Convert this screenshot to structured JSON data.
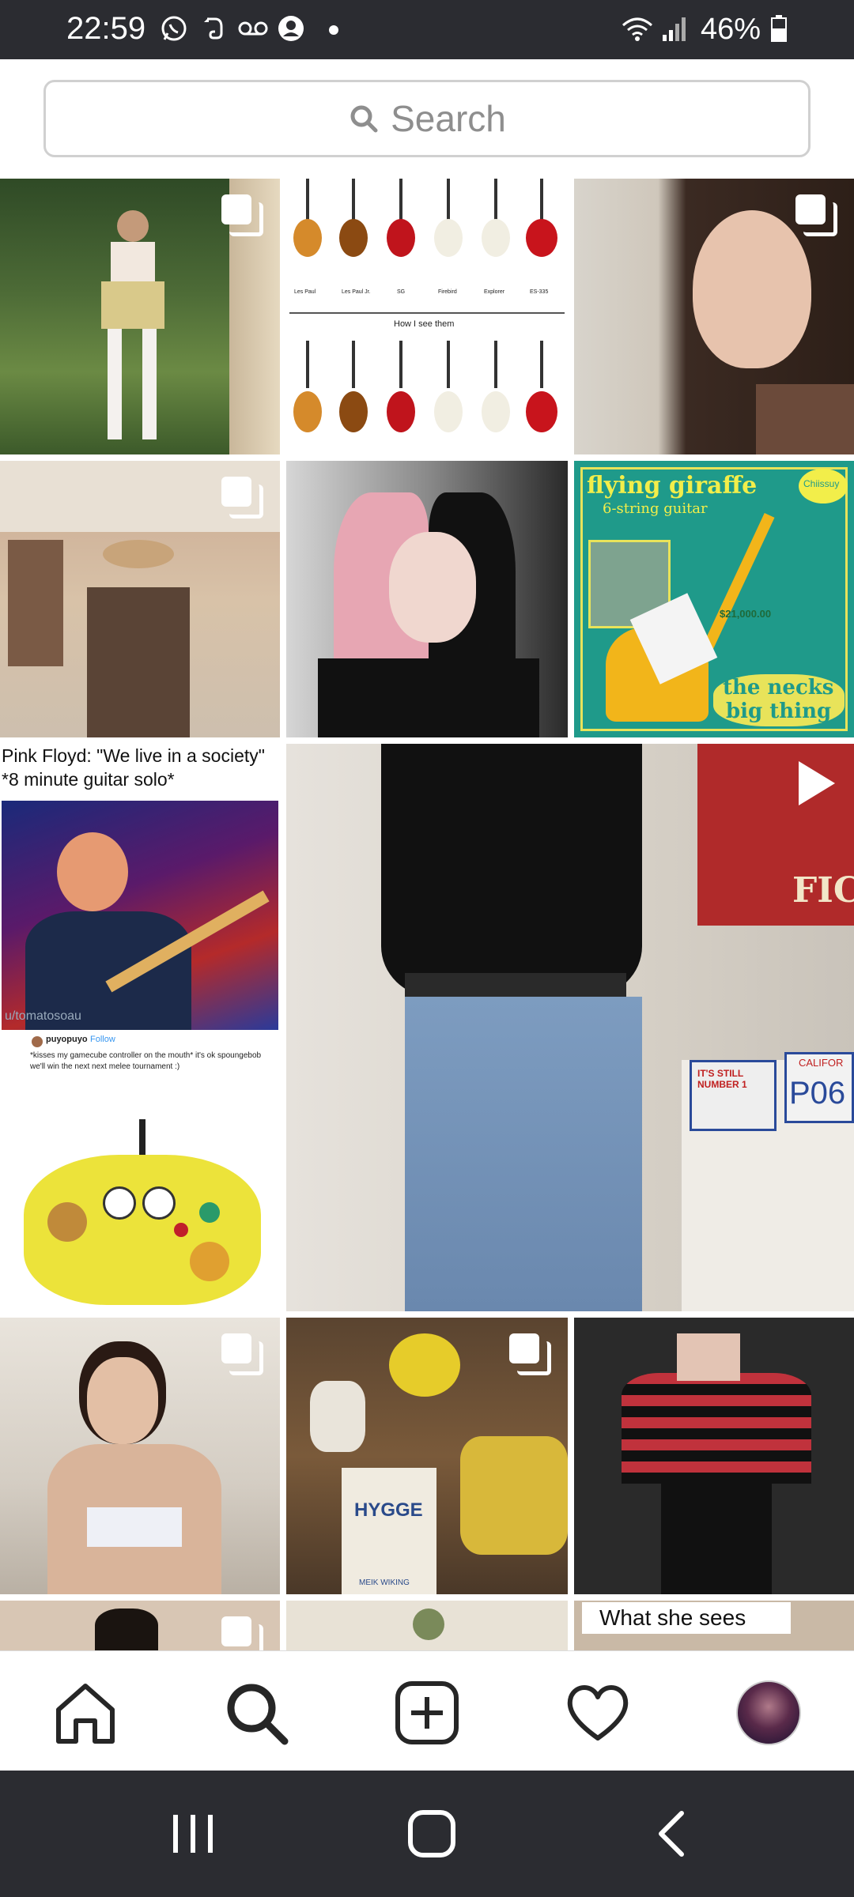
{
  "status_bar": {
    "time": "22:59",
    "battery": "46%",
    "icons": [
      "whatsapp-icon",
      "evernote-icon",
      "voicemail-icon",
      "account-icon",
      "dot-icon",
      "wifi-icon",
      "signal-icon",
      "battery-icon"
    ]
  },
  "search": {
    "placeholder": "Search"
  },
  "grid": {
    "guitars": {
      "labels_top": [
        "Les Paul",
        "Les Paul Jr.",
        "SG",
        "Firebird",
        "Explorer",
        "ES-335"
      ],
      "caption": "How I see them"
    },
    "flying_giraffe": {
      "title": "flying giraffe",
      "subtitle": "6-string guitar",
      "brand": "Chiissuy",
      "price": "$21,000.00",
      "tagline_1": "the necks",
      "tagline_2": "big thing"
    },
    "meme": {
      "line1": "Pink Floyd: \"We live in a society\"",
      "line2": "*8 minute guitar solo*",
      "username": "puyopuyo",
      "follow": "Follow",
      "post_text": "*kisses my gamecube controller on the mouth* it's ok spoungebob we'll win the next next melee tournament :)",
      "watermark": "u/tomatosoau"
    },
    "hygge_book": {
      "title": "HYGGE",
      "author": "MEIK WIKING"
    },
    "what_she_sees": {
      "caption": "What she sees"
    },
    "video_sign": {
      "plate": "P06",
      "state": "CALIFOR",
      "sign": "IT'S STILL NUMBER 1"
    },
    "poster": {
      "text": "FICT"
    }
  },
  "bottom_nav": {
    "items": [
      "home-icon",
      "search-icon",
      "add-post-icon",
      "activity-heart-icon",
      "profile-avatar"
    ]
  },
  "system_nav": {
    "items": [
      "recents-button",
      "home-button",
      "back-button"
    ]
  },
  "colors": {
    "status_bar_bg": "#2b2c31",
    "system_nav_bg": "#2b2c31",
    "search_border": "#d0d0d0",
    "search_text": "#8e8e8e"
  }
}
